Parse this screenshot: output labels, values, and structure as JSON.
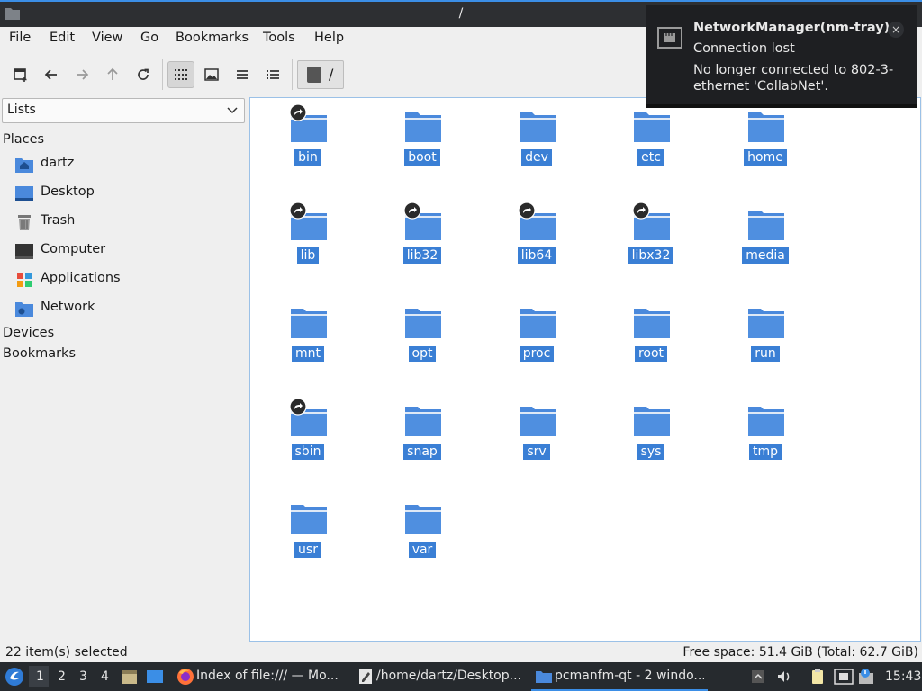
{
  "window": {
    "title": "/"
  },
  "menu": [
    "File",
    "Edit",
    "View",
    "Go",
    "Bookmarks",
    "Tools",
    "Help"
  ],
  "path": "/",
  "side": {
    "selector": "Lists",
    "places_label": "Places",
    "places": [
      {
        "label": "dartz",
        "icon": "home-folder-icon"
      },
      {
        "label": "Desktop",
        "icon": "desktop-icon"
      },
      {
        "label": "Trash",
        "icon": "trash-icon"
      },
      {
        "label": "Computer",
        "icon": "computer-icon"
      },
      {
        "label": "Applications",
        "icon": "applications-icon"
      },
      {
        "label": "Network",
        "icon": "network-icon"
      }
    ],
    "devices_label": "Devices",
    "bookmarks_label": "Bookmarks"
  },
  "folders": [
    {
      "name": "bin",
      "link": true
    },
    {
      "name": "boot",
      "link": false
    },
    {
      "name": "dev",
      "link": false
    },
    {
      "name": "etc",
      "link": false
    },
    {
      "name": "home",
      "link": false
    },
    {
      "name": "lib",
      "link": true
    },
    {
      "name": "lib32",
      "link": true
    },
    {
      "name": "lib64",
      "link": true
    },
    {
      "name": "libx32",
      "link": true
    },
    {
      "name": "media",
      "link": false
    },
    {
      "name": "mnt",
      "link": false
    },
    {
      "name": "opt",
      "link": false
    },
    {
      "name": "proc",
      "link": false
    },
    {
      "name": "root",
      "link": false
    },
    {
      "name": "run",
      "link": false
    },
    {
      "name": "sbin",
      "link": true
    },
    {
      "name": "snap",
      "link": false
    },
    {
      "name": "srv",
      "link": false
    },
    {
      "name": "sys",
      "link": false
    },
    {
      "name": "tmp",
      "link": false
    },
    {
      "name": "usr",
      "link": false
    },
    {
      "name": "var",
      "link": false
    }
  ],
  "status": {
    "left": "22 item(s) selected",
    "right": "Free space: 51.4 GiB (Total: 62.7 GiB)"
  },
  "taskbar": {
    "desktops": [
      "1",
      "2",
      "3",
      "4"
    ],
    "tasks": [
      {
        "label": "Index of file:/// — Mo...",
        "icon": "firefox-icon"
      },
      {
        "label": "/home/dartz/Desktop...",
        "icon": "text-editor-icon"
      },
      {
        "label": "pcmanfm-qt - 2 windo...",
        "icon": "folder-icon"
      }
    ],
    "clock": "15:43"
  },
  "notification": {
    "title": "NetworkManager(nm-tray)",
    "summary": "Connection lost",
    "body": "No longer connected to 802-3-ethernet 'CollabNet'.",
    "close": "×"
  },
  "colors": {
    "accent": "#3b8ee6",
    "folder": "#4a89dc",
    "selection": "#3a7fd5"
  }
}
